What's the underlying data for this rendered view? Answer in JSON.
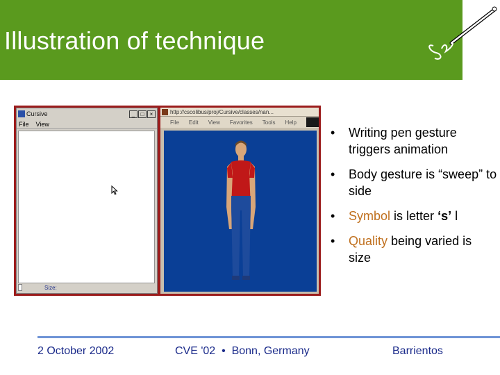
{
  "slide": {
    "title": "Illustration of technique",
    "colors": {
      "header_bg": "#5a9a1e",
      "accent": "#c0701e",
      "footer_text": "#1a2a8a",
      "footer_line": "#6f94d6"
    }
  },
  "screenshot": {
    "left_window": {
      "title": "Cursive",
      "menu": [
        "File",
        "View"
      ],
      "status_label": "Size:",
      "buttons": [
        "_",
        "□",
        "×"
      ]
    },
    "right_window": {
      "title": "http://cscolibus/proj/Cursive/classes/nan...",
      "menu": [
        "File",
        "Edit",
        "View",
        "Favorites",
        "Tools",
        "Help"
      ]
    },
    "icons": [
      "window-icon",
      "pen-icon",
      "cursor-icon",
      "avatar-figure"
    ]
  },
  "bullets": [
    {
      "dot": "•",
      "text": "Writing pen gesture triggers animation"
    },
    {
      "dot": "•",
      "text": "Body gesture is “sweep” to side"
    },
    {
      "dot": "•",
      "hl": "Symbol",
      "rest_a": " is letter ",
      "quote": "‘s’",
      "rest_b": " l"
    },
    {
      "dot": "•",
      "hl": "Quality",
      "rest_a": " being varied is size"
    }
  ],
  "footer": {
    "date": "2 October 2002",
    "event": "CVE '02  •  Bonn, Germany",
    "author": "Barrientos"
  }
}
